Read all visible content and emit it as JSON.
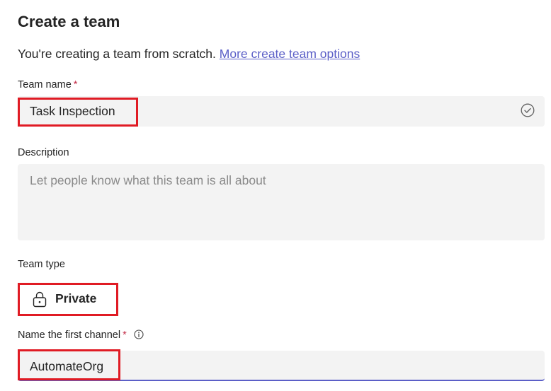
{
  "dialog": {
    "title": "Create a team",
    "intro_text": "You're creating a team from scratch.",
    "more_options_link": "More create team options"
  },
  "team_name": {
    "label": "Team name",
    "required_marker": "*",
    "value": "Task Inspection",
    "status_icon": "check-circle-icon"
  },
  "description": {
    "label": "Description",
    "value": "",
    "placeholder": "Let people know what this team is all about"
  },
  "team_type": {
    "label": "Team type",
    "value": "Private",
    "icon": "lock-icon"
  },
  "first_channel": {
    "label": "Name the first channel",
    "required_marker": "*",
    "info_icon": "info-icon",
    "value": "AutomateOrg"
  },
  "colors": {
    "accent": "#5b5fc7",
    "required": "#c4314b",
    "highlight_box": "#e01b24",
    "field_background": "#f3f3f3"
  }
}
